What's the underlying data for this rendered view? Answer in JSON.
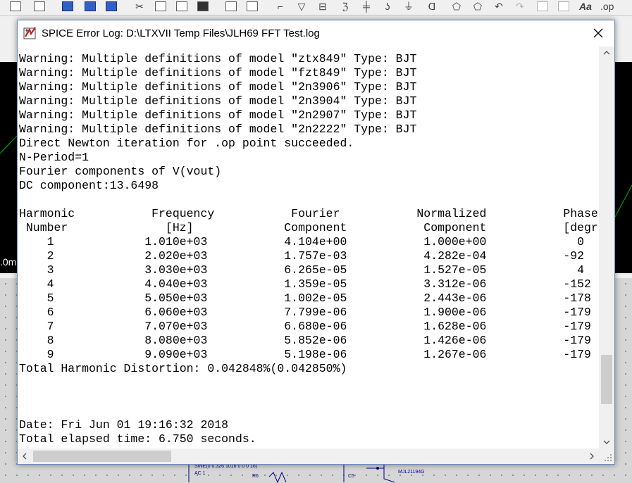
{
  "window": {
    "title": "SPICE Error Log: D:\\LTXVII Temp Files\\JLH69 FFT Test.log"
  },
  "log_lines": [
    "Warning: Multiple definitions of model \"ztx849\" Type: BJT",
    "Warning: Multiple definitions of model \"fzt849\" Type: BJT",
    "Warning: Multiple definitions of model \"2n3906\" Type: BJT",
    "Warning: Multiple definitions of model \"2n3904\" Type: BJT",
    "Warning: Multiple definitions of model \"2n2907\" Type: BJT",
    "Warning: Multiple definitions of model \"2n2222\" Type: BJT",
    "Direct Newton iteration for .op point succeeded.",
    "N-Period=1",
    "Fourier components of V(vout)",
    "DC component:13.6498",
    "",
    "Harmonic           Frequency           Fourier           Normalized           Phase",
    " Number              [Hz]             Component           Component           [degree]",
    "    1             1.010e+03           4.104e+00           1.000e+00             0",
    "    2             2.020e+03           1.757e-03           4.282e-04           -92",
    "    3             3.030e+03           6.265e-05           1.527e-05             4",
    "    4             4.040e+03           1.359e-05           3.312e-06           -152",
    "    5             5.050e+03           1.002e-05           2.443e-06           -178",
    "    6             6.060e+03           7.799e-06           1.900e-06           -179",
    "    7             7.070e+03           6.680e-06           1.628e-06           -179",
    "    8             8.080e+03           5.852e-06           1.426e-06           -179",
    "    9             9.090e+03           5.198e-06           1.267e-06           -179",
    "Total Harmonic Distortion: 0.042848%(0.042850%)",
    "",
    "",
    "",
    "Date: Fri Jun 01 19:16:32 2018",
    "Total elapsed time: 6.750 seconds."
  ],
  "background": {
    "plot_axis_label": ".0m",
    "schematic_labels": [
      "SINE(0 0.326 1016 0 0 0 16)",
      "AC 1",
      "R6",
      "C5",
      "MJL21194G"
    ]
  },
  "icons": {
    "title": "ltspice-app-icon",
    "close": "close-icon",
    "scroll_up": "chevron-up-icon",
    "scroll_down": "chevron-down-icon",
    "scroll_left": "chevron-left-icon",
    "scroll_right": "chevron-right-icon"
  },
  "colors": {
    "title_icon_red": "#c02020",
    "window_border": "#6b8fbf",
    "plot_background": "#000000"
  }
}
